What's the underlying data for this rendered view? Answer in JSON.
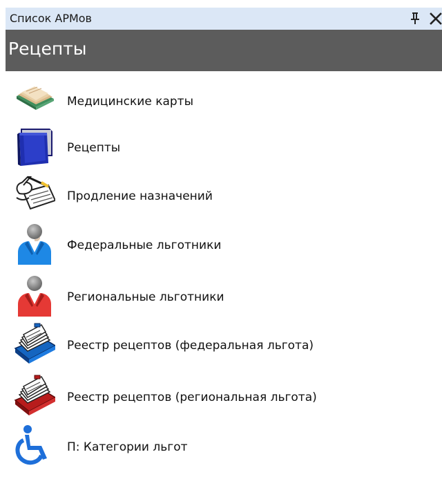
{
  "window": {
    "title": "Список АРМов",
    "pin_icon": "pin-icon",
    "close_icon": "close-icon"
  },
  "header": {
    "title": "Рецепты"
  },
  "items": [
    {
      "label": "Медицинские карты",
      "icon": "medical-cards-icon"
    },
    {
      "label": "Рецепты",
      "icon": "folder-icon"
    },
    {
      "label": "Продление назначений",
      "icon": "writing-hand-icon"
    },
    {
      "label": "Федеральные льготники",
      "icon": "person-blue-icon"
    },
    {
      "label": "Региональные льготники",
      "icon": "person-red-icon"
    },
    {
      "label": "Реестр рецептов (федеральная льгота)",
      "icon": "card-file-blue-icon"
    },
    {
      "label": "Реестр рецептов (региональная льгота)",
      "icon": "card-file-red-icon"
    },
    {
      "label": "П: Категории льгот",
      "icon": "wheelchair-icon"
    }
  ],
  "colors": {
    "titlebar_bg": "#dbe7f6",
    "header_bg": "#5c5c5c",
    "federal_blue": "#1e88e5",
    "regional_red": "#e53935",
    "registry_blue": "#1565c0",
    "registry_red": "#b71c1c"
  }
}
